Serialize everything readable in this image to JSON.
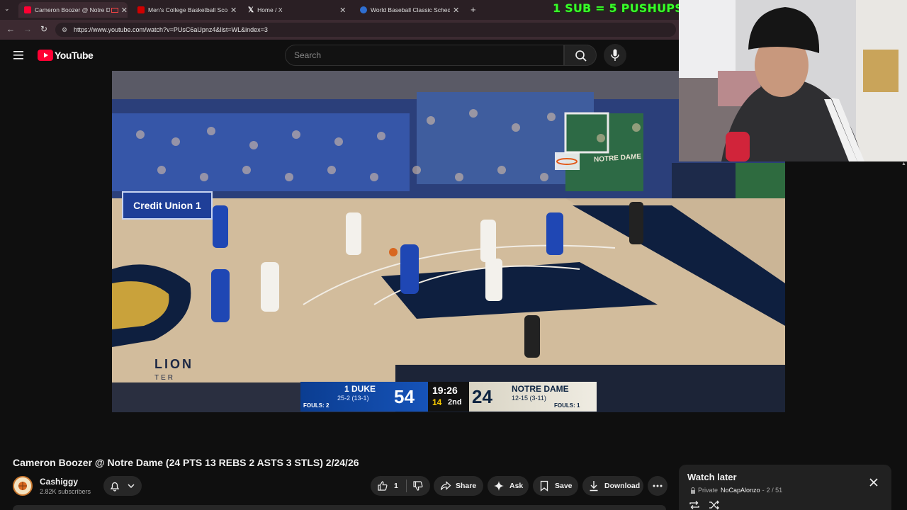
{
  "browser": {
    "tabs": [
      {
        "label": "Cameron Boozer @ Notre D",
        "active": true,
        "favicon_color": "#ff0033"
      },
      {
        "label": "Men's College Basketball Score",
        "active": false,
        "favicon_color": "#d00000"
      },
      {
        "label": "Home / X",
        "active": false,
        "favicon_color": "#ffffff"
      },
      {
        "label": "World Baseball Classic Schedule",
        "active": false,
        "favicon_color": "#2f6fd1"
      }
    ],
    "new_tab": "+",
    "url": "https://www.youtube.com/watch?v=PUsC6aUpnz4&list=WL&index=3"
  },
  "overlay": {
    "promo": "1 SUB = 5 PUSHUPS"
  },
  "youtube": {
    "logo_text": "YouTube",
    "search_placeholder": "Search"
  },
  "video": {
    "banner": "Credit Union 1",
    "court_text": "LION",
    "court_subtext": "TER",
    "ad_text": "NOTRE DAME",
    "score": {
      "home_rank_team": "1 DUKE",
      "home_record": "25-2 (13-1)",
      "home_score": "54",
      "home_fouls": "FOULS: 2",
      "clock": "19:26",
      "shot_clock": "14",
      "period": "2nd",
      "away_score": "24",
      "away_team": "NOTRE DAME",
      "away_record": "12-15 (3-11)",
      "away_fouls": "FOULS: 1"
    }
  },
  "info": {
    "title": "Cameron Boozer @ Notre Dame (24 PTS 13 REBS 2 ASTS 3 STLS) 2/24/26",
    "channel": "Cashiggy",
    "subscribers": "2.82K subscribers",
    "like_count": "1",
    "share": "Share",
    "ask": "Ask",
    "save": "Save",
    "download": "Download"
  },
  "playlist": {
    "title": "Watch later",
    "privacy": "Private",
    "owner": "NoCapAlonzo",
    "position": "2 / 51"
  },
  "colors": {
    "yt_red": "#ff0033",
    "duke_blue": "#0b3d91",
    "promo_green": "#39ff2a",
    "court": "#cbb596"
  }
}
